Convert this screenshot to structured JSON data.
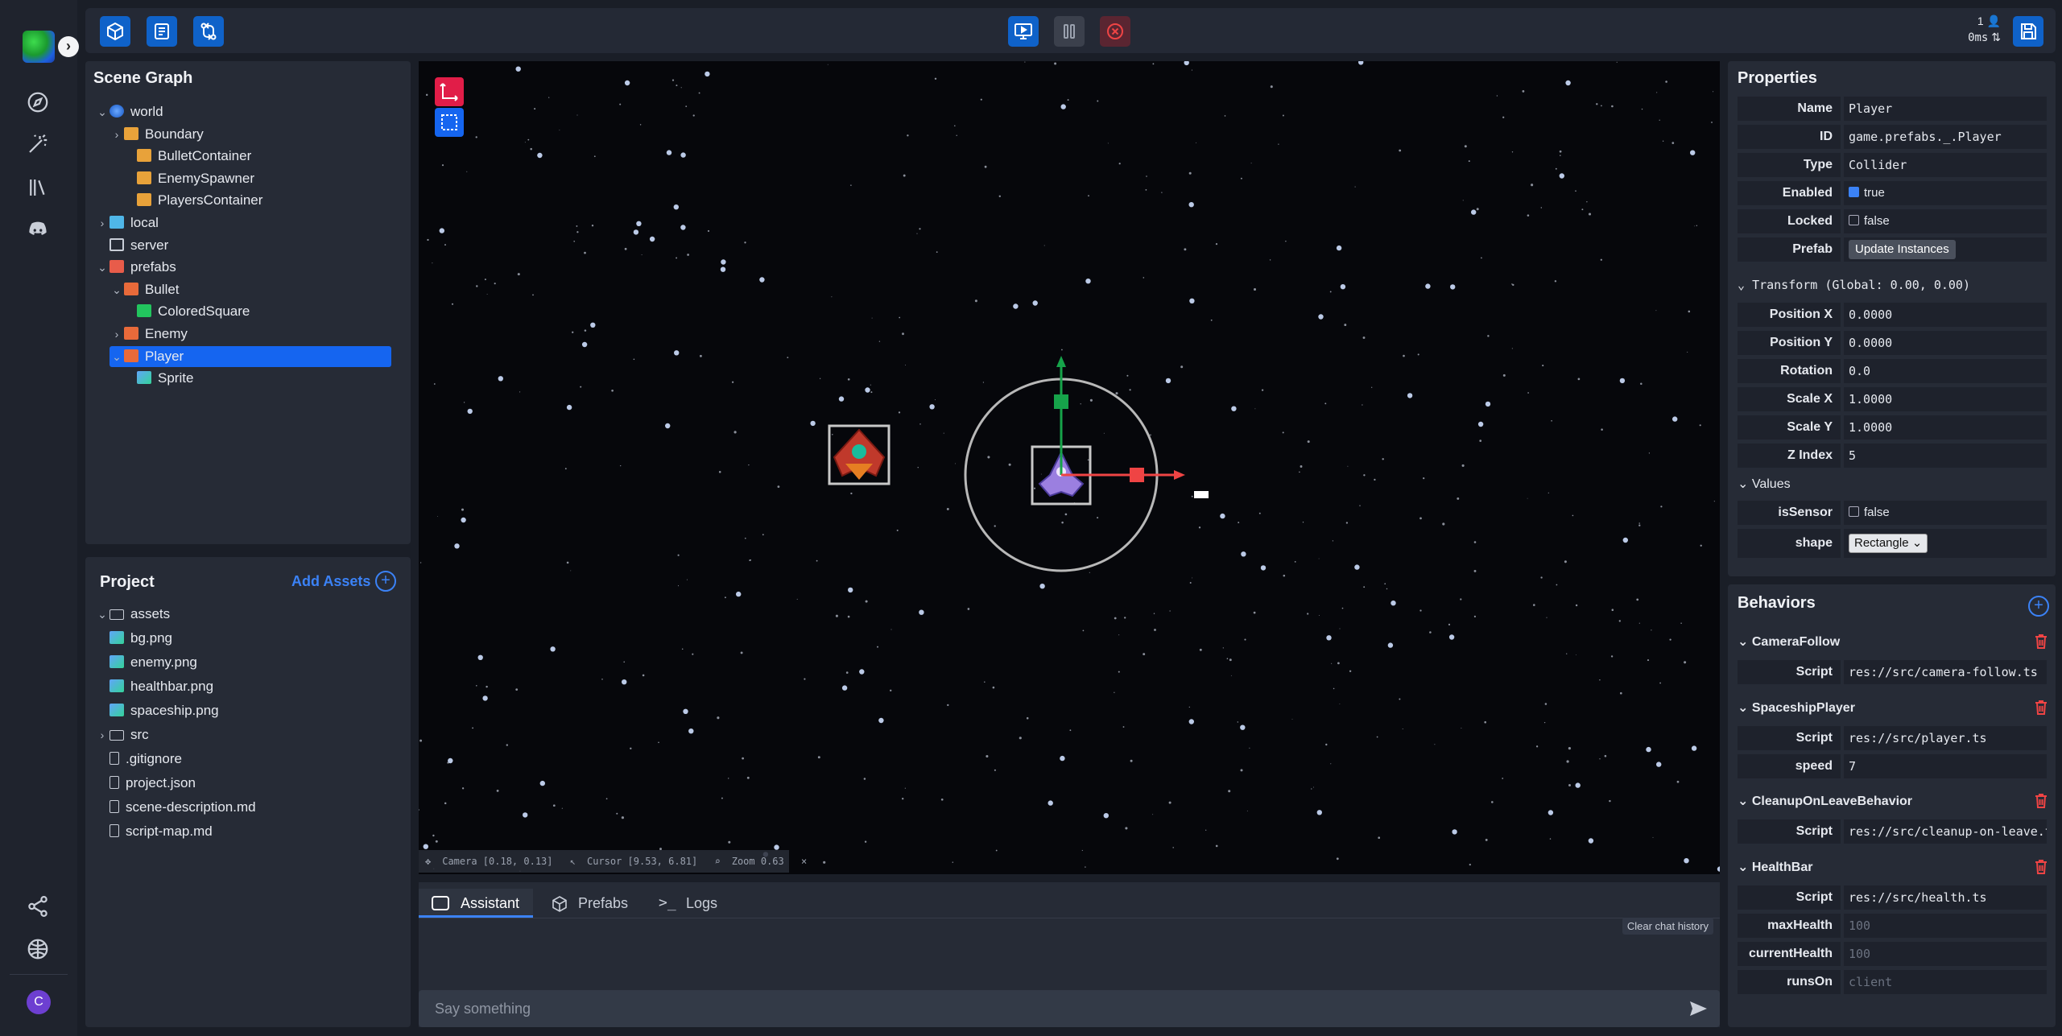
{
  "rail": {
    "expand_glyph": "›",
    "avatar_letter": "C"
  },
  "topbar": {
    "net": {
      "players": "1",
      "latency": "0ms"
    }
  },
  "scene_graph": {
    "title": "Scene Graph",
    "nodes": [
      {
        "label": "world",
        "icon": "globe-icon",
        "chevron": "v"
      },
      {
        "label": "Boundary",
        "icon": "cube-icon",
        "chevron": ">"
      },
      {
        "label": "BulletContainer",
        "icon": "cube-icon",
        "chevron": ""
      },
      {
        "label": "EnemySpawner",
        "icon": "cube-icon",
        "chevron": ""
      },
      {
        "label": "PlayersContainer",
        "icon": "cube-icon",
        "chevron": ""
      },
      {
        "label": "local",
        "icon": "laptop-icon",
        "chevron": ">"
      },
      {
        "label": "server",
        "icon": "server-icon",
        "chevron": ""
      },
      {
        "label": "prefabs",
        "icon": "document-icon",
        "chevron": "v"
      },
      {
        "label": "Bullet",
        "icon": "brick-icon",
        "chevron": "v"
      },
      {
        "label": "ColoredSquare",
        "icon": "green-square-icon",
        "chevron": ""
      },
      {
        "label": "Enemy",
        "icon": "brick-icon",
        "chevron": ">"
      },
      {
        "label": "Player",
        "icon": "brick-icon",
        "chevron": "v"
      },
      {
        "label": "Sprite",
        "icon": "image-icon",
        "chevron": ""
      }
    ]
  },
  "project": {
    "title": "Project",
    "add_assets": "Add Assets",
    "files": [
      {
        "label": "assets",
        "icon": "folder-icon",
        "chevron": "v"
      },
      {
        "label": "bg.png",
        "icon": "image-file-icon",
        "chevron": ""
      },
      {
        "label": "enemy.png",
        "icon": "image-file-icon",
        "chevron": ""
      },
      {
        "label": "healthbar.png",
        "icon": "image-file-icon",
        "chevron": ""
      },
      {
        "label": "spaceship.png",
        "icon": "image-file-icon",
        "chevron": ""
      },
      {
        "label": "src",
        "icon": "folder-icon",
        "chevron": ">"
      },
      {
        "label": ".gitignore",
        "icon": "file-icon",
        "chevron": ""
      },
      {
        "label": "project.json",
        "icon": "json-file-icon",
        "chevron": ""
      },
      {
        "label": "scene-description.md",
        "icon": "file-icon",
        "chevron": ""
      },
      {
        "label": "script-map.md",
        "icon": "file-icon",
        "chevron": ""
      }
    ]
  },
  "viewport": {
    "status": {
      "camera": "Camera [0.18, 0.13]",
      "cursor": "Cursor [9.53, 6.81]",
      "zoom": "Zoom 0.63",
      "close": "×"
    }
  },
  "chat": {
    "tabs": [
      "Assistant",
      "Prefabs",
      "Logs"
    ],
    "clear": "Clear chat history",
    "placeholder": "Say something"
  },
  "properties": {
    "title": "Properties",
    "name": {
      "label": "Name",
      "value": "Player"
    },
    "id": {
      "label": "ID",
      "value": "game.prefabs._.Player"
    },
    "type": {
      "label": "Type",
      "value": "Collider"
    },
    "enabled": {
      "label": "Enabled",
      "value": "true",
      "checked": true
    },
    "locked": {
      "label": "Locked",
      "value": "false",
      "checked": false
    },
    "prefab": {
      "label": "Prefab",
      "button": "Update Instances"
    },
    "transform_header": "Transform (Global: 0.00, 0.00)",
    "position_x": {
      "label": "Position X",
      "value": "0.0000"
    },
    "position_y": {
      "label": "Position Y",
      "value": "0.0000"
    },
    "rotation": {
      "label": "Rotation",
      "value": "0.0"
    },
    "scale_x": {
      "label": "Scale X",
      "value": "1.0000"
    },
    "scale_y": {
      "label": "Scale Y",
      "value": "1.0000"
    },
    "z_index": {
      "label": "Z Index",
      "value": "5"
    },
    "values_header": "Values",
    "is_sensor": {
      "label": "isSensor",
      "value": "false",
      "checked": false
    },
    "shape": {
      "label": "shape",
      "value": "Rectangle"
    }
  },
  "behaviors": {
    "title": "Behaviors",
    "camera_follow": {
      "name": "CameraFollow",
      "script_label": "Script",
      "script": "res://src/camera-follow.ts"
    },
    "spaceship_player": {
      "name": "SpaceshipPlayer",
      "script_label": "Script",
      "script": "res://src/player.ts",
      "speed_label": "speed",
      "speed": "7"
    },
    "cleanup": {
      "name": "CleanupOnLeaveBehavior",
      "script_label": "Script",
      "script": "res://src/cleanup-on-leave.ts"
    },
    "healthbar": {
      "name": "HealthBar",
      "script_label": "Script",
      "script": "res://src/health.ts",
      "max_label": "maxHealth",
      "max_placeholder": "100",
      "current_label": "currentHealth",
      "current_placeholder": "100",
      "runs_on_label": "runsOn",
      "runs_on_placeholder": "client"
    }
  },
  "colors": {
    "accent": "#1565f0",
    "danger": "#ef4444",
    "panel": "#262b36"
  }
}
